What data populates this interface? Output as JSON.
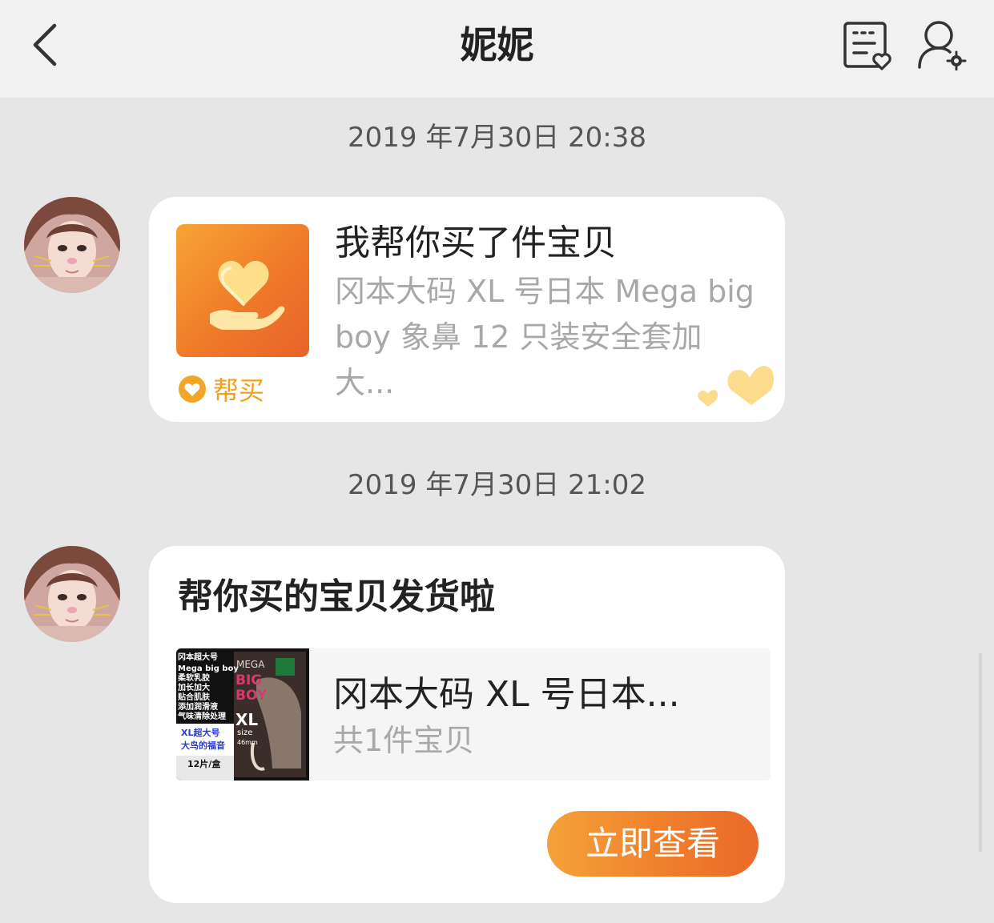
{
  "nav": {
    "title": "妮妮",
    "back_icon": "chevron-left-icon",
    "list_icon": "favorites-list-icon",
    "settings_icon": "user-settings-icon"
  },
  "messages": [
    {
      "time": "2019 年7月30日 20:38",
      "card": {
        "title": "我帮你买了件宝贝",
        "desc_line1": "冈本大码 XL 号日本 Mega big",
        "desc_line2": "boy 象鼻 12 只装安全套加大...",
        "tag_label": "帮买",
        "icon": "heart-in-hand-icon"
      }
    },
    {
      "time": "2019 年7月30日 21:02",
      "card": {
        "title": "帮你买的宝贝发货啦",
        "goods_name": "冈本大码 XL 号日本...",
        "goods_count": "共1件宝贝",
        "button_label": "立即查看",
        "goods_image_text": {
          "brand": "冈本超大号",
          "line1": "Mega big boy",
          "line2": "柔软乳胶",
          "line3": "加长加大",
          "line4": "贴合肌肤",
          "line5": "添加润滑液",
          "line6": "气味清除处理",
          "badge1": "XL超大号",
          "badge2": "大鸟的福音",
          "pack": "12片/盒",
          "box_top": "MEGA",
          "box_big": "BIG",
          "box_boy": "BOY",
          "box_xl": "XL",
          "box_size": "size",
          "box_mm": "46mm"
        }
      }
    }
  ],
  "colors": {
    "accent_orange": "#ef7a2a",
    "tag_gold": "#f0a020",
    "background": "#e6e6e6"
  }
}
